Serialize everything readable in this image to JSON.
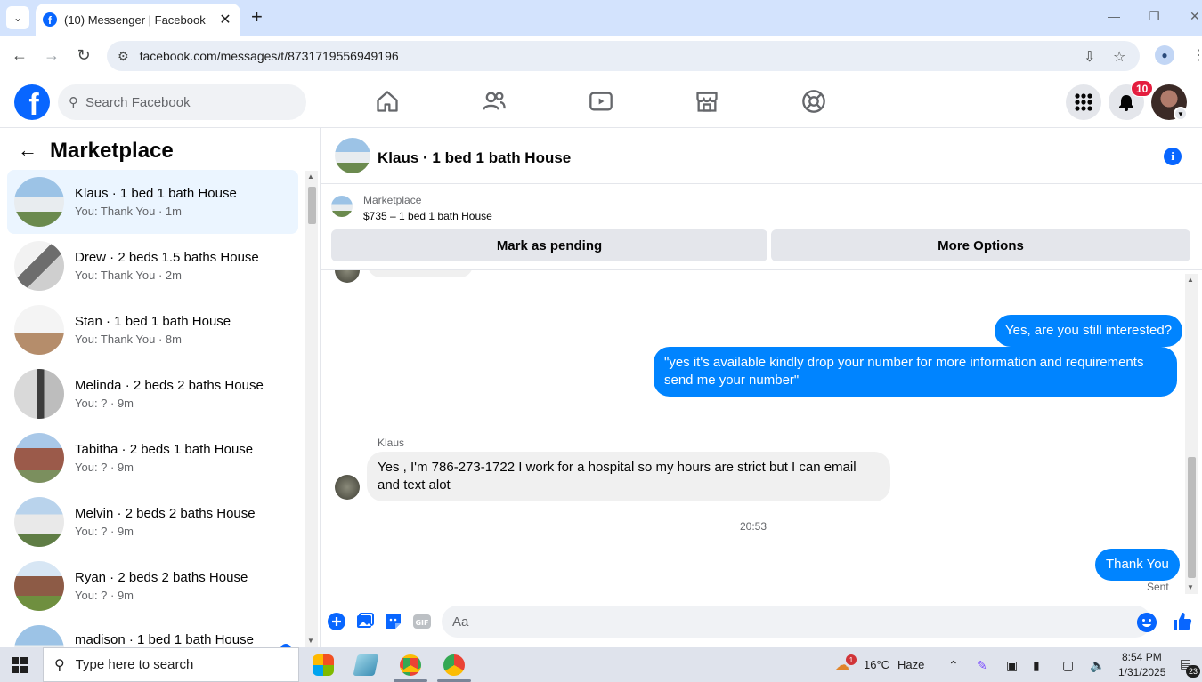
{
  "browser": {
    "tab_title": "(10) Messenger | Facebook",
    "url": "facebook.com/messages/t/8731719556949196"
  },
  "fb": {
    "search_placeholder": "Search Facebook",
    "notification_count": "10",
    "brand_color": "#0866ff"
  },
  "left": {
    "title": "Marketplace",
    "conversations": [
      {
        "name": "Klaus · 1 bed 1 bath House",
        "sub": "You: Thank You · 1m"
      },
      {
        "name": "Drew · 2 beds 1.5 baths House",
        "sub": "You: Thank You · 2m"
      },
      {
        "name": "Stan · 1 bed 1 bath House",
        "sub": "You: Thank You · 8m"
      },
      {
        "name": "Melinda · 2 beds 2 baths House",
        "sub": "You: ? · 9m"
      },
      {
        "name": "Tabitha · 2 beds 1 bath House",
        "sub": "You: ? · 9m"
      },
      {
        "name": "Melvin · 2 beds 2 baths House",
        "sub": "You: ? · 9m"
      },
      {
        "name": "Ryan · 2 beds 2 baths House",
        "sub": "You: ? · 9m"
      },
      {
        "name": "madison · 1 bed 1 bath House",
        "sub": ""
      }
    ]
  },
  "chat": {
    "title": "Klaus · 1 bed 1 bath House",
    "marketplace_label": "Marketplace",
    "listing": "$735 – 1 bed 1 bath House",
    "mark_pending": "Mark as pending",
    "more_options": "More Options",
    "messages": {
      "out1": "Yes, are you still interested?",
      "out2": "\"yes it's available kindly drop your number for more information and requirements send me your number\"",
      "sender": "Klaus",
      "in1": "Yes , I'm 786-273-1722 I work for a hospital so my hours are strict but I can email and text alot",
      "time": "20:53",
      "out3": "Thank You",
      "status": "Sent"
    },
    "composer_placeholder": "Aa",
    "bubble_color": "#0084ff"
  },
  "taskbar": {
    "search_placeholder": "Type here to search",
    "weather_temp": "16°C",
    "weather_cond": "Haze",
    "weather_badge": "1",
    "time": "8:54 PM",
    "date": "1/31/2025",
    "notif_count": "23"
  }
}
